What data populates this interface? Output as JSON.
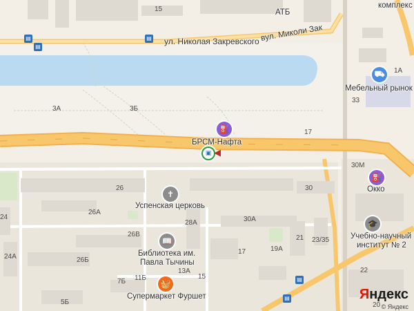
{
  "map": {
    "streets": {
      "main": "ул. Николая Закревского",
      "main_ua": "вул. Миколи Зак"
    },
    "building_numbers": [
      "15",
      "3А",
      "3Б",
      "17",
      "26",
      "26А",
      "26В",
      "26Б",
      "24",
      "24А",
      "28А",
      "30",
      "30А",
      "21",
      "23/35",
      "19А",
      "17",
      "13А",
      "15",
      "11Б",
      "7Б",
      "5Б",
      "22",
      "1А",
      "33",
      "30М",
      "20"
    ],
    "pois": {
      "atb": "АТБ",
      "complex": "комплекс",
      "furniture_market": "Мебельный рынок",
      "brsm": "БРСМ-Нафта",
      "uspenska": "Успенская церковь",
      "library_line1": "Библиотека им.",
      "library_line2": "Павла Тычины",
      "okko": "Окко",
      "institute_line1": "Учебно-научный",
      "institute_line2": "институт № 2",
      "furshet": "Супермаркет Фуршет"
    },
    "icons": {
      "church": "church-icon",
      "library": "book-icon",
      "fuel": "fuel-icon",
      "shop": "shopping-basket-icon",
      "education": "graduation-cap-icon",
      "market": "shopping-cart-icon",
      "bus": "bus-stop-icon"
    },
    "colors": {
      "main_road": "#f8c76b",
      "water": "#b9daf0",
      "block": "#e8e2d6",
      "building": "#dedad2"
    },
    "branding": {
      "logo_ya": "Я",
      "logo_rest": "ндекс",
      "copyright": "© Яндекс"
    }
  }
}
